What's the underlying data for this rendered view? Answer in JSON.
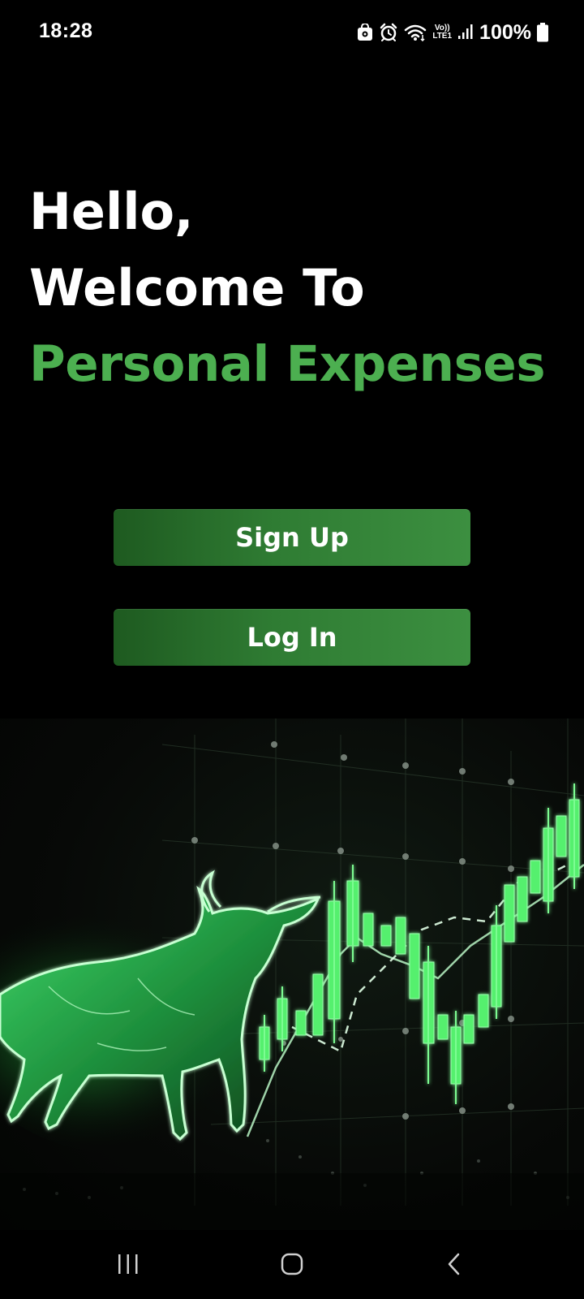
{
  "status_bar": {
    "time": "18:28",
    "volte_top": "Vo))",
    "volte_bottom": "LTE1",
    "battery_percent": "100%",
    "icons": [
      "shopping-bag-icon",
      "alarm-icon",
      "wifi-icon",
      "volte-lte-icon",
      "signal-icon",
      "battery-icon"
    ]
  },
  "heading": {
    "line1": "Hello,",
    "line2": "Welcome To",
    "line3": "Personal Expenses"
  },
  "buttons": {
    "signup_label": "Sign Up",
    "login_label": "Log In"
  },
  "colors": {
    "background": "#000000",
    "accent_green": "#4caf50",
    "button_green": "#2f7c33",
    "chart_green": "#4cff6a"
  },
  "hero": {
    "image": "bull-stock-chart-illustration"
  },
  "nav_bar": {
    "icons": [
      "recent-apps-icon",
      "home-icon",
      "back-icon"
    ]
  }
}
